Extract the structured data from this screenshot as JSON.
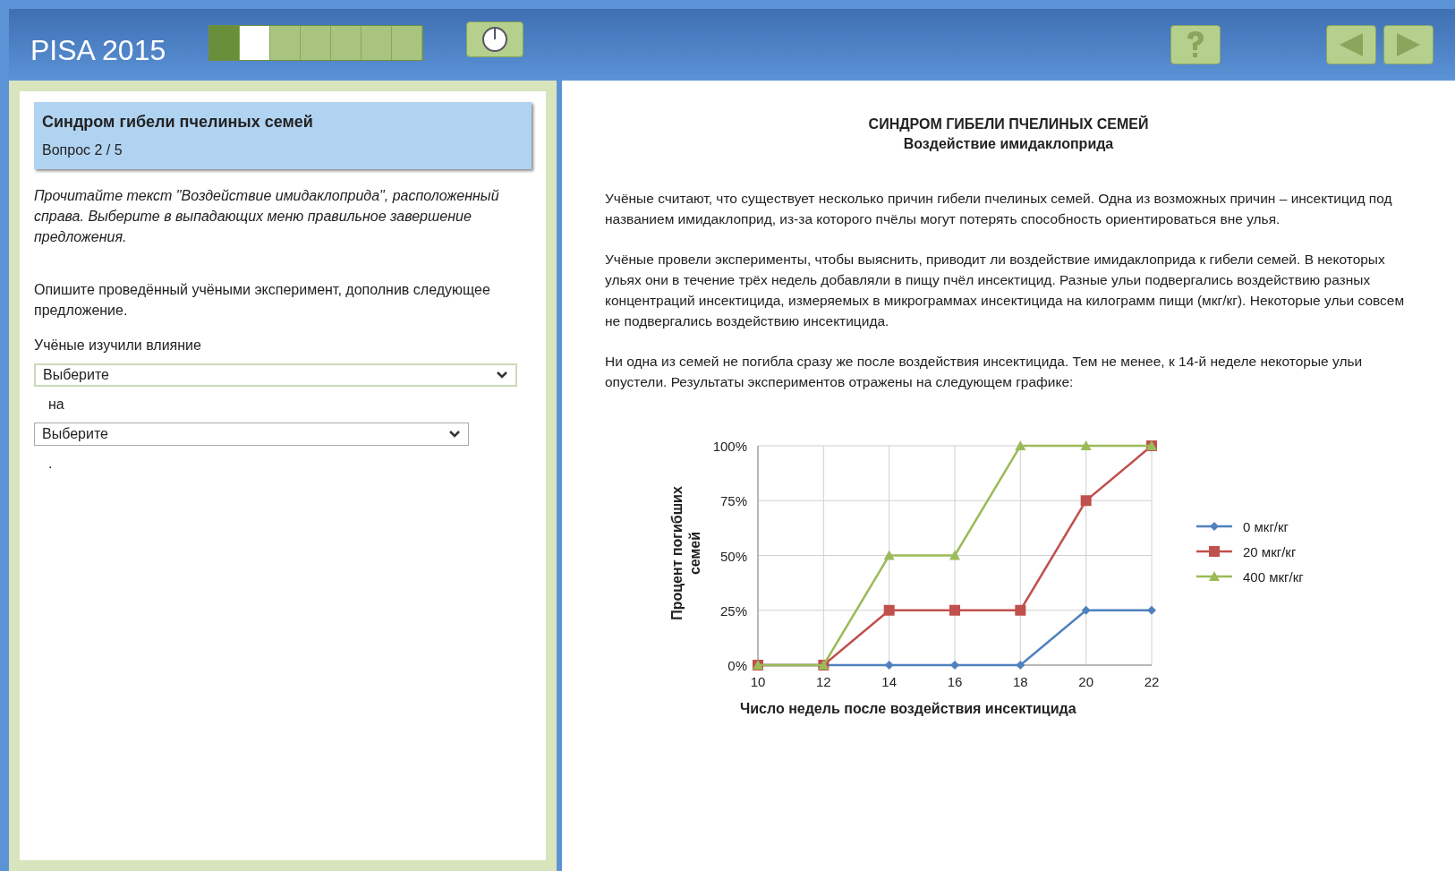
{
  "header": {
    "title": "PISA 2015",
    "progress": [
      {
        "kind": "done"
      },
      {
        "kind": "current"
      },
      {
        "kind": "todo"
      },
      {
        "kind": "todo"
      },
      {
        "kind": "todo"
      },
      {
        "kind": "todo"
      },
      {
        "kind": "todo"
      }
    ]
  },
  "question_panel": {
    "title": "Синдром гибели пчелиных семей",
    "subtitle": "Вопрос 2 / 5",
    "instruction": "Прочитайте текст \"Воздействие имидаклоприда\", расположенный справа. Выберите в выпадающих меню правильное завершение предложения.",
    "prompt": "Опишите проведённый учёными эксперимент, дополнив следующее предложение.",
    "sentence": [
      {
        "kind": "text",
        "text": "Учёные изучили влияние"
      },
      {
        "kind": "select",
        "value": "Выберите"
      },
      {
        "kind": "text",
        "text": "на"
      },
      {
        "kind": "select",
        "value": "Выберите"
      },
      {
        "kind": "text",
        "text": "."
      }
    ]
  },
  "article": {
    "title": "СИНДРОМ ГИБЕЛИ ПЧЕЛИНЫХ СЕМЕЙ",
    "subtitle": "Воздействие имидаклоприда",
    "paragraphs": [
      "Учёные считают, что существует несколько причин гибели пчелиных семей. Одна из возможных причин – инсектицид под названием имидаклоприд, из-за которого пчёлы могут потерять способность ориентироваться вне улья.",
      "Учёные провели эксперименты, чтобы выяснить, приводит ли воздействие имидаклоприда к гибели семей. В некоторых ульях они в течение трёх недель добавляли в пищу пчёл инсектицид. Разные ульи подвергались воздействию разных концентраций инсектицида, измеряемых в микрограммах инсектицида на килограмм пищи (мкг/кг). Некоторые ульи совсем не подвергались воздействию инсектицида.",
      "Ни одна из семей не погибла сразу же после воздействия инсектицида. Тем не менее, к 14-й неделе некоторые ульи опустели. Результаты экспериментов отражены на следующем графике:"
    ],
    "chart_data": {
      "type": "line",
      "xlabel": "Число недель после воздействия инсектицида",
      "ylabel": "Процент погибших семей",
      "x": [
        10,
        12,
        14,
        16,
        18,
        20,
        22
      ],
      "xlim": [
        10,
        22
      ],
      "xticks": [
        10,
        12,
        14,
        16,
        18,
        20,
        22
      ],
      "grid": true,
      "legend": true,
      "ylim": [
        0,
        100
      ],
      "yticks": [
        {
          "value": 0,
          "label": "0%"
        },
        {
          "value": 25,
          "label": "25%"
        },
        {
          "value": 50,
          "label": "50%"
        },
        {
          "value": 75,
          "label": "75%"
        },
        {
          "value": 100,
          "label": "100%"
        }
      ],
      "series": [
        {
          "name": "0 мкг/кг",
          "color": "#4f81bd",
          "marker": "diamond",
          "values": [
            0,
            0,
            0,
            0,
            0,
            25,
            25
          ]
        },
        {
          "name": "20 мкг/кг",
          "color": "#c0504d",
          "marker": "square",
          "values": [
            0,
            0,
            25,
            25,
            25,
            75,
            100
          ]
        },
        {
          "name": "400 мкг/кг",
          "color": "#9bbb59",
          "marker": "triangle",
          "values": [
            0,
            0,
            50,
            50,
            100,
            100,
            100
          ]
        }
      ]
    }
  }
}
